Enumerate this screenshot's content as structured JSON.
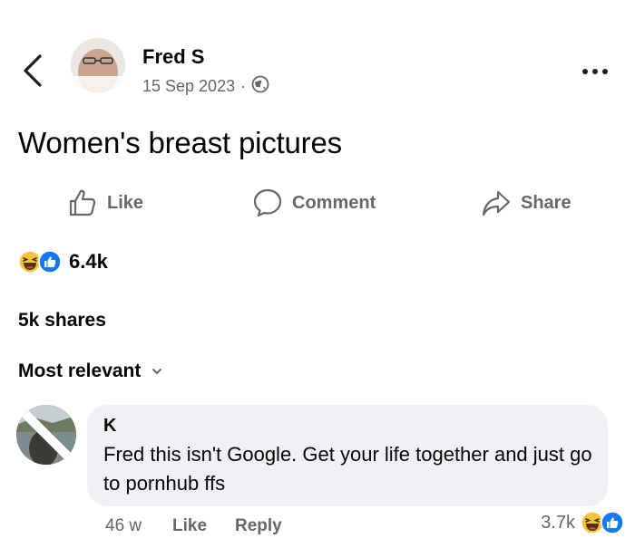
{
  "post": {
    "author": "Fred S",
    "date": "15 Sep 2023",
    "dot": "·",
    "audience_icon": "globe-icon",
    "text": "Women's breast pictures"
  },
  "actions": {
    "like": "Like",
    "comment": "Comment",
    "share": "Share"
  },
  "stats": {
    "reactions_count": "6.4k",
    "reaction_icons": [
      "haha-icon",
      "like-icon"
    ],
    "shares": "5k shares"
  },
  "comments_sort": {
    "label": "Most relevant"
  },
  "comment": {
    "author": "K",
    "text": "Fred this isn't Google. Get your life together and just go to pornhub ffs",
    "time": "46 w",
    "like_label": "Like",
    "reply_label": "Reply",
    "reactions_count": "3.7k",
    "reaction_icons": [
      "haha-icon",
      "like-icon"
    ]
  },
  "colors": {
    "primary_text": "#050505",
    "secondary_text": "#65676b",
    "bubble_bg": "#eff1f4",
    "like_blue": "#1877f2",
    "haha_yellow": "#f7c23d"
  }
}
